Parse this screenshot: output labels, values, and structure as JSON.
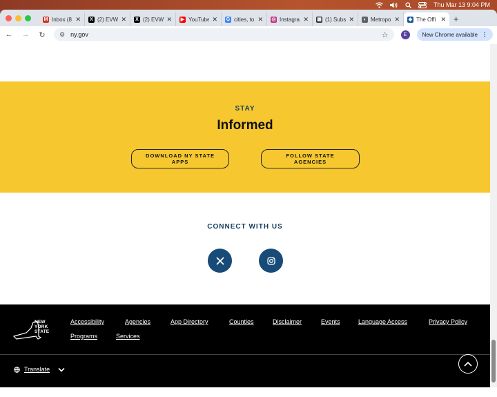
{
  "menubar": {
    "datetime": "Thu Mar 13  9:04 PM"
  },
  "tabs": [
    {
      "title": "Inbox (8",
      "icon": "gmail-icon",
      "color": "#d93025",
      "glyph": "M"
    },
    {
      "title": "(2) EVW",
      "icon": "x-icon",
      "color": "#000000",
      "glyph": "X"
    },
    {
      "title": "(2) EVW",
      "icon": "x-icon",
      "color": "#000000",
      "glyph": "X"
    },
    {
      "title": "YouTube",
      "icon": "youtube-icon",
      "color": "#ff0000",
      "glyph": "▶"
    },
    {
      "title": "cities, to",
      "icon": "google-icon",
      "color": "#4285f4",
      "glyph": "G"
    },
    {
      "title": "Instagra",
      "icon": "instagram-icon",
      "color": "#c13584",
      "glyph": "◎"
    },
    {
      "title": "(1) Subs",
      "icon": "substack-icon",
      "color": "#333333",
      "glyph": "▦"
    },
    {
      "title": "Metropo",
      "icon": "page-icon",
      "color": "#5f6368",
      "glyph": "◐"
    },
    {
      "title": "The Offi",
      "icon": "nygov-icon",
      "color": "#1a5a96",
      "glyph": "◆",
      "active": true
    }
  ],
  "toolbar": {
    "url": "ny.gov",
    "new_chrome": "New Chrome available",
    "profile_initial": "E"
  },
  "stay_section": {
    "kicker": "STAY",
    "heading": "Informed",
    "download_button": "DOWNLOAD NY STATE APPS",
    "follow_button": "FOLLOW STATE AGENCIES",
    "bg_color": "#f6c72f"
  },
  "connect": {
    "title": "CONNECT WITH US",
    "social": [
      "x-icon",
      "instagram-icon"
    ]
  },
  "footer": {
    "logo_text": "NEW YORK STATE",
    "links": [
      "Accessibility",
      "Agencies",
      "App Directory",
      "Counties",
      "Disclaimer",
      "Events",
      "Language Access",
      "Privacy Policy",
      "Programs",
      "Services"
    ],
    "translate": "Translate"
  }
}
